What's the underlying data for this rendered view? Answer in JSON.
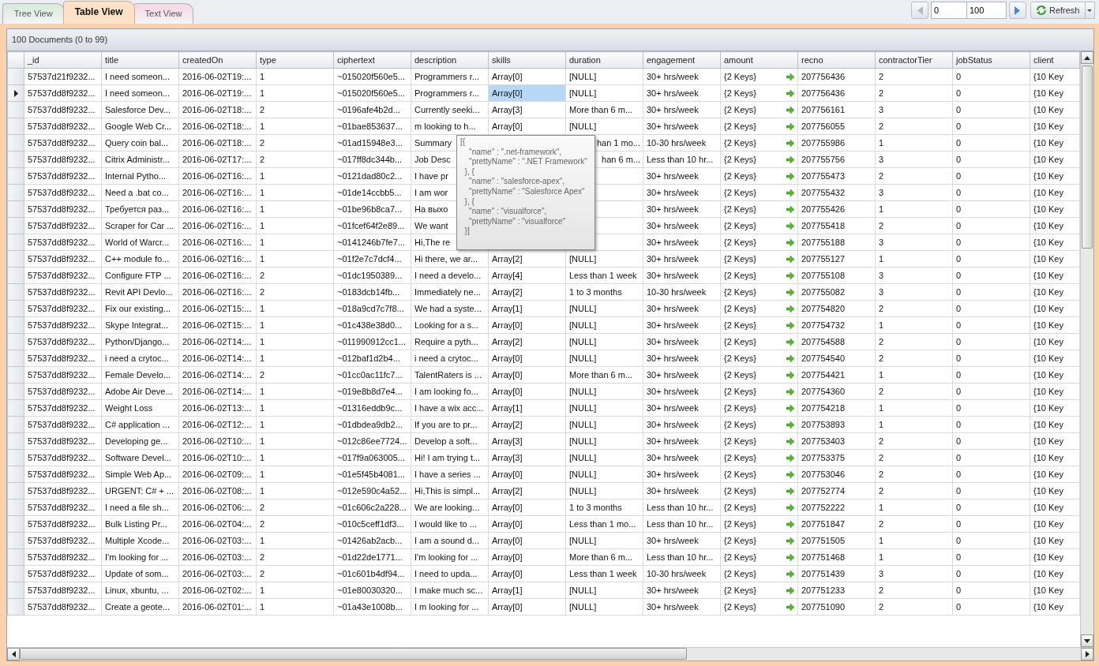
{
  "tabs": [
    {
      "label": "Tree View",
      "selected": false,
      "color": "#d5ebd9"
    },
    {
      "label": "Table View",
      "selected": true,
      "color": "#fde2c8"
    },
    {
      "label": "Text View",
      "selected": false,
      "color": "#f6d6e4"
    }
  ],
  "pager": {
    "start": "0",
    "count": "100",
    "refresh": "Refresh"
  },
  "status": "100 Documents (0 to 99)",
  "table": {
    "columns": [
      "_id",
      "title",
      "createdOn",
      "type",
      "ciphertext",
      "description",
      "skills",
      "duration",
      "engagement",
      "amount",
      "recno",
      "contractorTier",
      "jobStatus",
      "client"
    ],
    "rows": [
      {
        "selected": false,
        "cells": [
          "57537d21f9232...",
          "I need someon...",
          "2016-06-02T19:...",
          "1",
          "~015020f560e5...",
          "Programmers r...",
          "Array[0]",
          "[NULL]",
          "30+ hrs/week",
          "{2 Keys}",
          "207756436",
          "2",
          "0",
          "{10 Key"
        ]
      },
      {
        "selected": true,
        "cells": [
          "57537dd8f9232...",
          "I need someon...",
          "2016-06-02T19:...",
          "1",
          "~015020f560e5...",
          "Programmers r...",
          {
            "text": "Array[0]",
            "selected": true
          },
          "[NULL]",
          "30+ hrs/week",
          "{2 Keys}",
          "207756436",
          "2",
          "0",
          "{10 Key"
        ]
      },
      {
        "selected": false,
        "cells": [
          "57537dd8f9232...",
          "Salesforce Dev...",
          "2016-06-02T18:...",
          "2",
          "~0196afe4b2d...",
          "Currently seeki...",
          "Array[3]",
          "More than 6 m...",
          "30+ hrs/week",
          "{2 Keys}",
          "207756161",
          "3",
          "0",
          "{10 Key"
        ]
      },
      {
        "selected": false,
        "cells": [
          "57537dd8f9232...",
          "Google Web Cr...",
          "2016-06-02T18:...",
          "1",
          "~01bae853637...",
          "m looking to h...",
          "Array[0]",
          "[NULL]",
          "30+ hrs/week",
          "{2 Keys}",
          "207756055",
          "2",
          "0",
          "{10 Key"
        ]
      },
      {
        "selected": false,
        "cells": [
          "57537dd8f9232...",
          "Query coin bal...",
          "2016-06-02T18:...",
          "2",
          "~01ad15948e3...",
          "Summary",
          null,
          {
            "text": "han 1 mo...",
            "covered": true
          },
          "10-30 hrs/week",
          "{2 Keys}",
          "207755986",
          "1",
          "0",
          "{10 Key"
        ]
      },
      {
        "selected": false,
        "cells": [
          "57537dd8f9232...",
          "Citrix Administr...",
          "2016-06-02T17:...",
          "2",
          "~017ff8dc344b...",
          "Job Desc",
          null,
          {
            "text": "han 6 m...",
            "covered": true
          },
          "Less than 10 hr...",
          "{2 Keys}",
          "207755756",
          "3",
          "0",
          "{10 Key"
        ]
      },
      {
        "selected": false,
        "cells": [
          "57537dd8f9232...",
          "Internal  Pytho...",
          "2016-06-02T16:...",
          "1",
          "~0121dad80c2...",
          "I have pr",
          null,
          null,
          "30+ hrs/week",
          "{2 Keys}",
          "207755473",
          "2",
          "0",
          "{10 Key"
        ]
      },
      {
        "selected": false,
        "cells": [
          "57537dd8f9232...",
          "Need a .bat co...",
          "2016-06-02T16:...",
          "1",
          "~01de14ccbb5...",
          "I am wor",
          null,
          null,
          "30+ hrs/week",
          "{2 Keys}",
          "207755432",
          "3",
          "0",
          "{10 Key"
        ]
      },
      {
        "selected": false,
        "cells": [
          "57537dd8f9232...",
          "Требуется раз...",
          "2016-06-02T16:...",
          "1",
          "~01be96b8ca7...",
          "На выхо",
          null,
          null,
          "30+ hrs/week",
          "{2 Keys}",
          "207755426",
          "1",
          "0",
          "{10 Key"
        ]
      },
      {
        "selected": false,
        "cells": [
          "57537dd8f9232...",
          "Scraper for Car ...",
          "2016-06-02T16:...",
          "1",
          "~01fcef64f2e89...",
          "We want",
          null,
          null,
          "30+ hrs/week",
          "{2 Keys}",
          "207755418",
          "2",
          "0",
          "{10 Key"
        ]
      },
      {
        "selected": false,
        "cells": [
          "57537dd8f9232...",
          "World of Warcr...",
          "2016-06-02T16:...",
          "1",
          "~0141246b7fe7...",
          "Hi,The re",
          null,
          null,
          "30+ hrs/week",
          "{2 Keys}",
          "207755188",
          "3",
          "0",
          "{10 Key"
        ]
      },
      {
        "selected": false,
        "cells": [
          "57537dd8f9232...",
          "C++ module fo...",
          "2016-06-02T16:...",
          "1",
          "~01f2e7c7dcf4...",
          "Hi there, we ar...",
          "Array[2]",
          "[NULL]",
          "30+ hrs/week",
          "{2 Keys}",
          "207755127",
          "1",
          "0",
          "{10 Key"
        ]
      },
      {
        "selected": false,
        "cells": [
          "57537dd8f9232...",
          "Configure FTP ...",
          "2016-06-02T16:...",
          "2",
          "~01dc1950389...",
          "I need a develo...",
          "Array[4]",
          "Less than 1 week",
          "30+ hrs/week",
          "{2 Keys}",
          "207755108",
          "3",
          "0",
          "{10 Key"
        ]
      },
      {
        "selected": false,
        "cells": [
          "57537dd8f9232...",
          "Revit API Devlo...",
          "2016-06-02T16:...",
          "2",
          "~0183dcb14fb...",
          "Immediately ne...",
          "Array[2]",
          "1 to 3 months",
          "10-30 hrs/week",
          "{2 Keys}",
          "207755082",
          "3",
          "0",
          "{10 Key"
        ]
      },
      {
        "selected": false,
        "cells": [
          "57537dd8f9232...",
          "Fix our existing...",
          "2016-06-02T15:...",
          "1",
          "~018a9cd7c7f8...",
          "We had a syste...",
          "Array[1]",
          "[NULL]",
          "30+ hrs/week",
          "{2 Keys}",
          "207754820",
          "2",
          "0",
          "{10 Key"
        ]
      },
      {
        "selected": false,
        "cells": [
          "57537dd8f9232...",
          "Skype Integrat...",
          "2016-06-02T15:...",
          "1",
          "~01c438e38d0...",
          "Looking for a s...",
          "Array[0]",
          "[NULL]",
          "30+ hrs/week",
          "{2 Keys}",
          "207754732",
          "1",
          "0",
          "{10 Key"
        ]
      },
      {
        "selected": false,
        "cells": [
          "57537dd8f9232...",
          "Python/Django...",
          "2016-06-02T14:...",
          "1",
          "~011990912cc1...",
          "Require a pyth...",
          "Array[2]",
          "[NULL]",
          "30+ hrs/week",
          "{2 Keys}",
          "207754588",
          "2",
          "0",
          "{10 Key"
        ]
      },
      {
        "selected": false,
        "cells": [
          "57537dd8f9232...",
          "i need a crytoc...",
          "2016-06-02T14:...",
          "1",
          "~012baf1d2b4...",
          "i need a crytoc...",
          "Array[0]",
          "[NULL]",
          "30+ hrs/week",
          "{2 Keys}",
          "207754540",
          "2",
          "0",
          "{10 Key"
        ]
      },
      {
        "selected": false,
        "cells": [
          "57537dd8f9232...",
          "Female Develo...",
          "2016-06-02T14:...",
          "2",
          "~01cc0ac11fc7...",
          "TalentRaters is ...",
          "Array[0]",
          "More than 6 m...",
          "30+ hrs/week",
          "{2 Keys}",
          "207754421",
          "1",
          "0",
          "{10 Key"
        ]
      },
      {
        "selected": false,
        "cells": [
          "57537dd8f9232...",
          "Adobe Air Deve...",
          "2016-06-02T14:...",
          "1",
          "~019e8b8d7e4...",
          "I am looking fo...",
          "Array[0]",
          "[NULL]",
          "30+ hrs/week",
          "{2 Keys}",
          "207754360",
          "2",
          "0",
          "{10 Key"
        ]
      },
      {
        "selected": false,
        "cells": [
          "57537dd8f9232...",
          "Weight Loss",
          "2016-06-02T13:...",
          "1",
          "~01316eddb9c...",
          "I have a wix acc...",
          "Array[1]",
          "[NULL]",
          "30+ hrs/week",
          "{2 Keys}",
          "207754218",
          "1",
          "0",
          "{10 Key"
        ]
      },
      {
        "selected": false,
        "cells": [
          "57537dd8f9232...",
          "C# application ...",
          "2016-06-02T12:...",
          "1",
          "~01dbdea9db2...",
          "If you are to pr...",
          "Array[2]",
          "[NULL]",
          "30+ hrs/week",
          "{2 Keys}",
          "207753893",
          "1",
          "0",
          "{10 Key"
        ]
      },
      {
        "selected": false,
        "cells": [
          "57537dd8f9232...",
          "Developing ge...",
          "2016-06-02T10:...",
          "1",
          "~012c86ee7724...",
          "Develop a soft...",
          "Array[3]",
          "[NULL]",
          "30+ hrs/week",
          "{2 Keys}",
          "207753403",
          "2",
          "0",
          "{10 Key"
        ]
      },
      {
        "selected": false,
        "cells": [
          "57537dd8f9232...",
          "Software Devel...",
          "2016-06-02T10:...",
          "1",
          "~017f9a063005...",
          "Hi! I am trying t...",
          "Array[3]",
          "[NULL]",
          "30+ hrs/week",
          "{2 Keys}",
          "207753375",
          "2",
          "0",
          "{10 Key"
        ]
      },
      {
        "selected": false,
        "cells": [
          "57537dd8f9232...",
          "Simple Web Ap...",
          "2016-06-02T09:...",
          "1",
          "~01e5f45b4081...",
          "I have a series ...",
          "Array[0]",
          "[NULL]",
          "30+ hrs/week",
          "{2 Keys}",
          "207753046",
          "2",
          "0",
          "{10 Key"
        ]
      },
      {
        "selected": false,
        "cells": [
          "57537dd8f9232...",
          "URGENT: C# + ...",
          "2016-06-02T08:...",
          "1",
          "~012e590c4a52...",
          "Hi,This is simpl...",
          "Array[2]",
          "[NULL]",
          "30+ hrs/week",
          "{2 Keys}",
          "207752774",
          "2",
          "0",
          "{10 Key"
        ]
      },
      {
        "selected": false,
        "cells": [
          "57537dd8f9232...",
          "I need a file sh...",
          "2016-06-02T06:...",
          "2",
          "~01c606c2a228...",
          "We are looking...",
          "Array[0]",
          "1 to 3 months",
          "Less than 10 hr...",
          "{2 Keys}",
          "207752222",
          "1",
          "0",
          "{10 Key"
        ]
      },
      {
        "selected": false,
        "cells": [
          "57537dd8f9232...",
          "Bulk Listing Pr...",
          "2016-06-02T04:...",
          "2",
          "~010c5ceff1df3...",
          "I would like to ...",
          "Array[0]",
          "Less than 1 mo...",
          "Less than 10 hr...",
          "{2 Keys}",
          "207751847",
          "2",
          "0",
          "{10 Key"
        ]
      },
      {
        "selected": false,
        "cells": [
          "57537dd8f9232...",
          "Multiple Xcode...",
          "2016-06-02T03:...",
          "1",
          "~01426ab2acb...",
          "I am a sound d...",
          "Array[0]",
          "[NULL]",
          "30+ hrs/week",
          "{2 Keys}",
          "207751505",
          "1",
          "0",
          "{10 Key"
        ]
      },
      {
        "selected": false,
        "cells": [
          "57537dd8f9232...",
          "I'm looking for ...",
          "2016-06-02T03:...",
          "2",
          "~01d22de1771...",
          "I'm looking for ...",
          "Array[0]",
          "More than 6 m...",
          "Less than 10 hr...",
          "{2 Keys}",
          "207751468",
          "1",
          "0",
          "{10 Key"
        ]
      },
      {
        "selected": false,
        "cells": [
          "57537dd8f9232...",
          "Update of som...",
          "2016-06-02T03:...",
          "2",
          "~01c601b4df94...",
          "I need to upda...",
          "Array[0]",
          "Less than 1 week",
          "10-30 hrs/week",
          "{2 Keys}",
          "207751439",
          "3",
          "0",
          "{10 Key"
        ]
      },
      {
        "selected": false,
        "cells": [
          "57537dd8f9232...",
          "Linux, xbuntu, ...",
          "2016-06-02T02:...",
          "1",
          "~01e80030320...",
          "I make much sc...",
          "Array[1]",
          "[NULL]",
          "30+ hrs/week",
          "{2 Keys}",
          "207751233",
          "2",
          "0",
          "{10 Key"
        ]
      },
      {
        "selected": false,
        "cells": [
          "57537dd8f9232...",
          "Create a geote...",
          "2016-06-02T01:...",
          "1",
          "~01a43e1008b...",
          "I m looking for ...",
          "Array[0]",
          "[NULL]",
          "30+ hrs/week",
          "{2 Keys}",
          "207751090",
          "2",
          "0",
          "{10 Key"
        ]
      }
    ]
  },
  "tooltip": {
    "text": "[{\n    \"name\" : \".net-framework\",\n    \"prettyName\" : \".NET Framework\"\n  }, {\n    \"name\" : \"salesforce-apex\",\n    \"prettyName\" : \"Salesforce Apex\"\n  }, {\n    \"name\" : \"visualforce\",\n    \"prettyName\" : \"visualforce\"\n  }]"
  }
}
